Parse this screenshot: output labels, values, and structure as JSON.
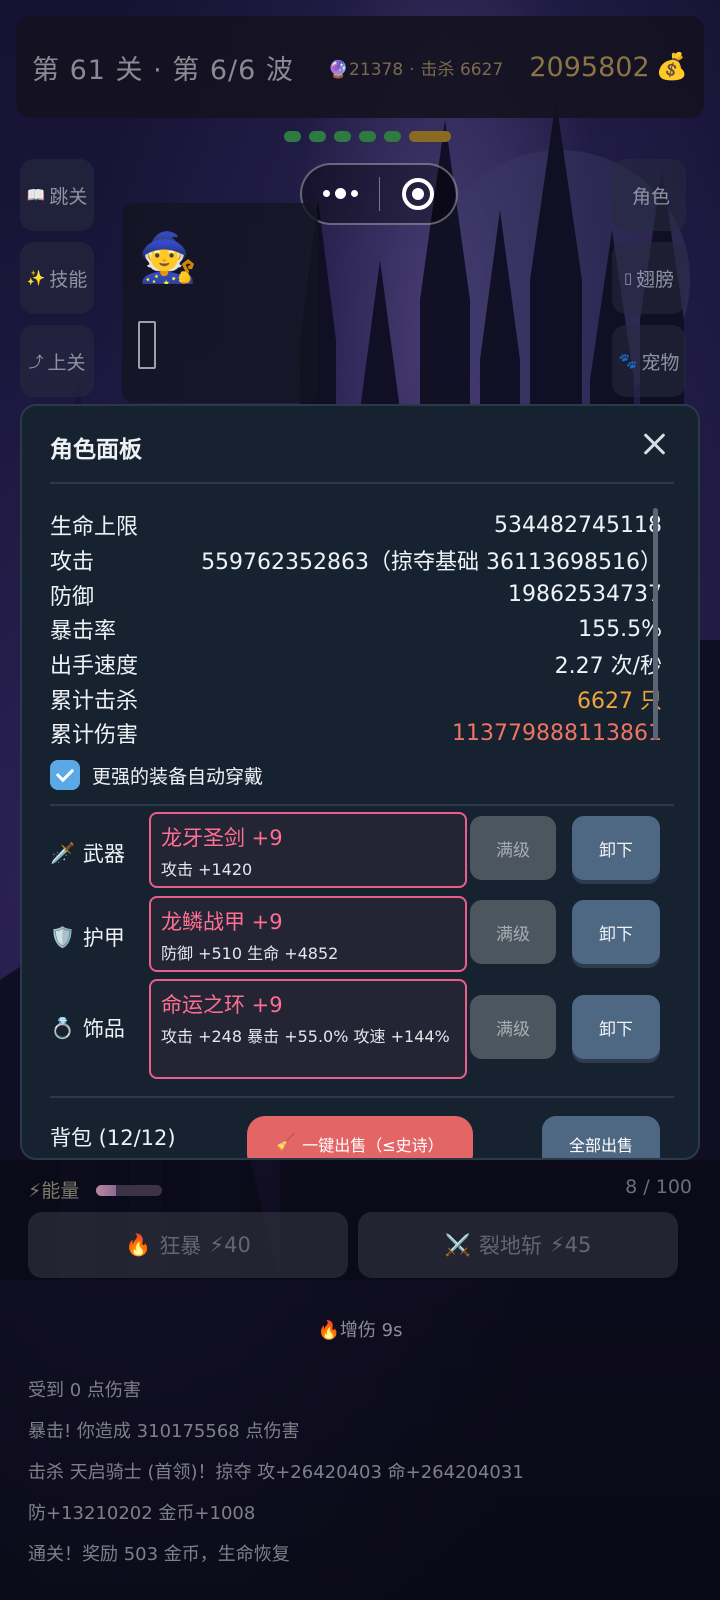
{
  "header": {
    "stage": "第 61 关 · 第 6/6 波",
    "gems": "🔮21378",
    "kills": "击杀 6627",
    "gold": "2095802",
    "gold_icon": "money-bag-icon"
  },
  "side_buttons": {
    "left": [
      {
        "icon": "📖",
        "label": "跳关"
      },
      {
        "icon": "✨",
        "label": "技能"
      },
      {
        "icon": "⤴",
        "label": "上关"
      }
    ],
    "right": [
      {
        "icon": "",
        "label": "角色"
      },
      {
        "icon": "▯",
        "label": "翅膀"
      },
      {
        "icon": "🐾",
        "label": "宠物"
      }
    ]
  },
  "character": {
    "avatar": "🧙"
  },
  "panel": {
    "title": "角色面板",
    "stats": [
      {
        "label": "生命上限",
        "value": "534482745118"
      },
      {
        "label": "攻击",
        "value": "559762352863（掠夺基础 36113698516）"
      },
      {
        "label": "防御",
        "value": "19862534737"
      },
      {
        "label": "暴击率",
        "value": "155.5%"
      },
      {
        "label": "出手速度",
        "value": "2.27 次/秒"
      },
      {
        "label": "累计击杀",
        "value": "6627 只"
      },
      {
        "label": "累计伤害",
        "value": "113779888113861"
      }
    ],
    "auto_equip_label": "更强的装备自动穿戴",
    "auto_equip_checked": true,
    "slots": [
      {
        "icon": "🗡️",
        "label": "武器",
        "item": "龙牙圣剑 +9",
        "desc": "攻击 +1420",
        "max_label": "满级",
        "unequip_label": "卸下"
      },
      {
        "icon": "🛡️",
        "label": "护甲",
        "item": "龙鳞战甲 +9",
        "desc": "防御 +510  生命 +4852",
        "max_label": "满级",
        "unequip_label": "卸下"
      },
      {
        "icon": "💍",
        "label": "饰品",
        "item": "命运之环 +9",
        "desc": "攻击 +248  暴击 +55.0%  攻速 +144%",
        "max_label": "满级",
        "unequip_label": "卸下"
      }
    ],
    "bag_label": "背包 (12/12)",
    "quick_sell_icon": "🧹",
    "quick_sell_label": "一键出售（≤史诗）",
    "sell_all_label": "全部出售"
  },
  "energy": {
    "label": "⚡能量",
    "value": "8 / 100",
    "level": 0.08
  },
  "skills": [
    {
      "icon": "🔥",
      "label": "狂暴",
      "cost": "⚡40"
    },
    {
      "icon": "⚔️",
      "label": "裂地斩",
      "cost": "⚡45"
    }
  ],
  "buff": "🔥增伤 9s",
  "log": [
    "受到 0 点伤害",
    "暴击! 你造成 310175568 点伤害",
    "击杀 天启骑士 (首领)！掠夺 攻+26420403 命+264204031",
    "防+13210202 金币+1008",
    "通关！奖励 503 金币，生命恢复"
  ],
  "colors": {
    "panel_bg": "#162230",
    "legendary_border": "#ea5e8a",
    "item_name": "#ff6f91",
    "kills_value": "#f0a43a",
    "damage_value": "#ee7563",
    "checkbox": "#5aa9e6",
    "unequip_button": "#4e6883",
    "quick_sell_button": "#e46565"
  }
}
